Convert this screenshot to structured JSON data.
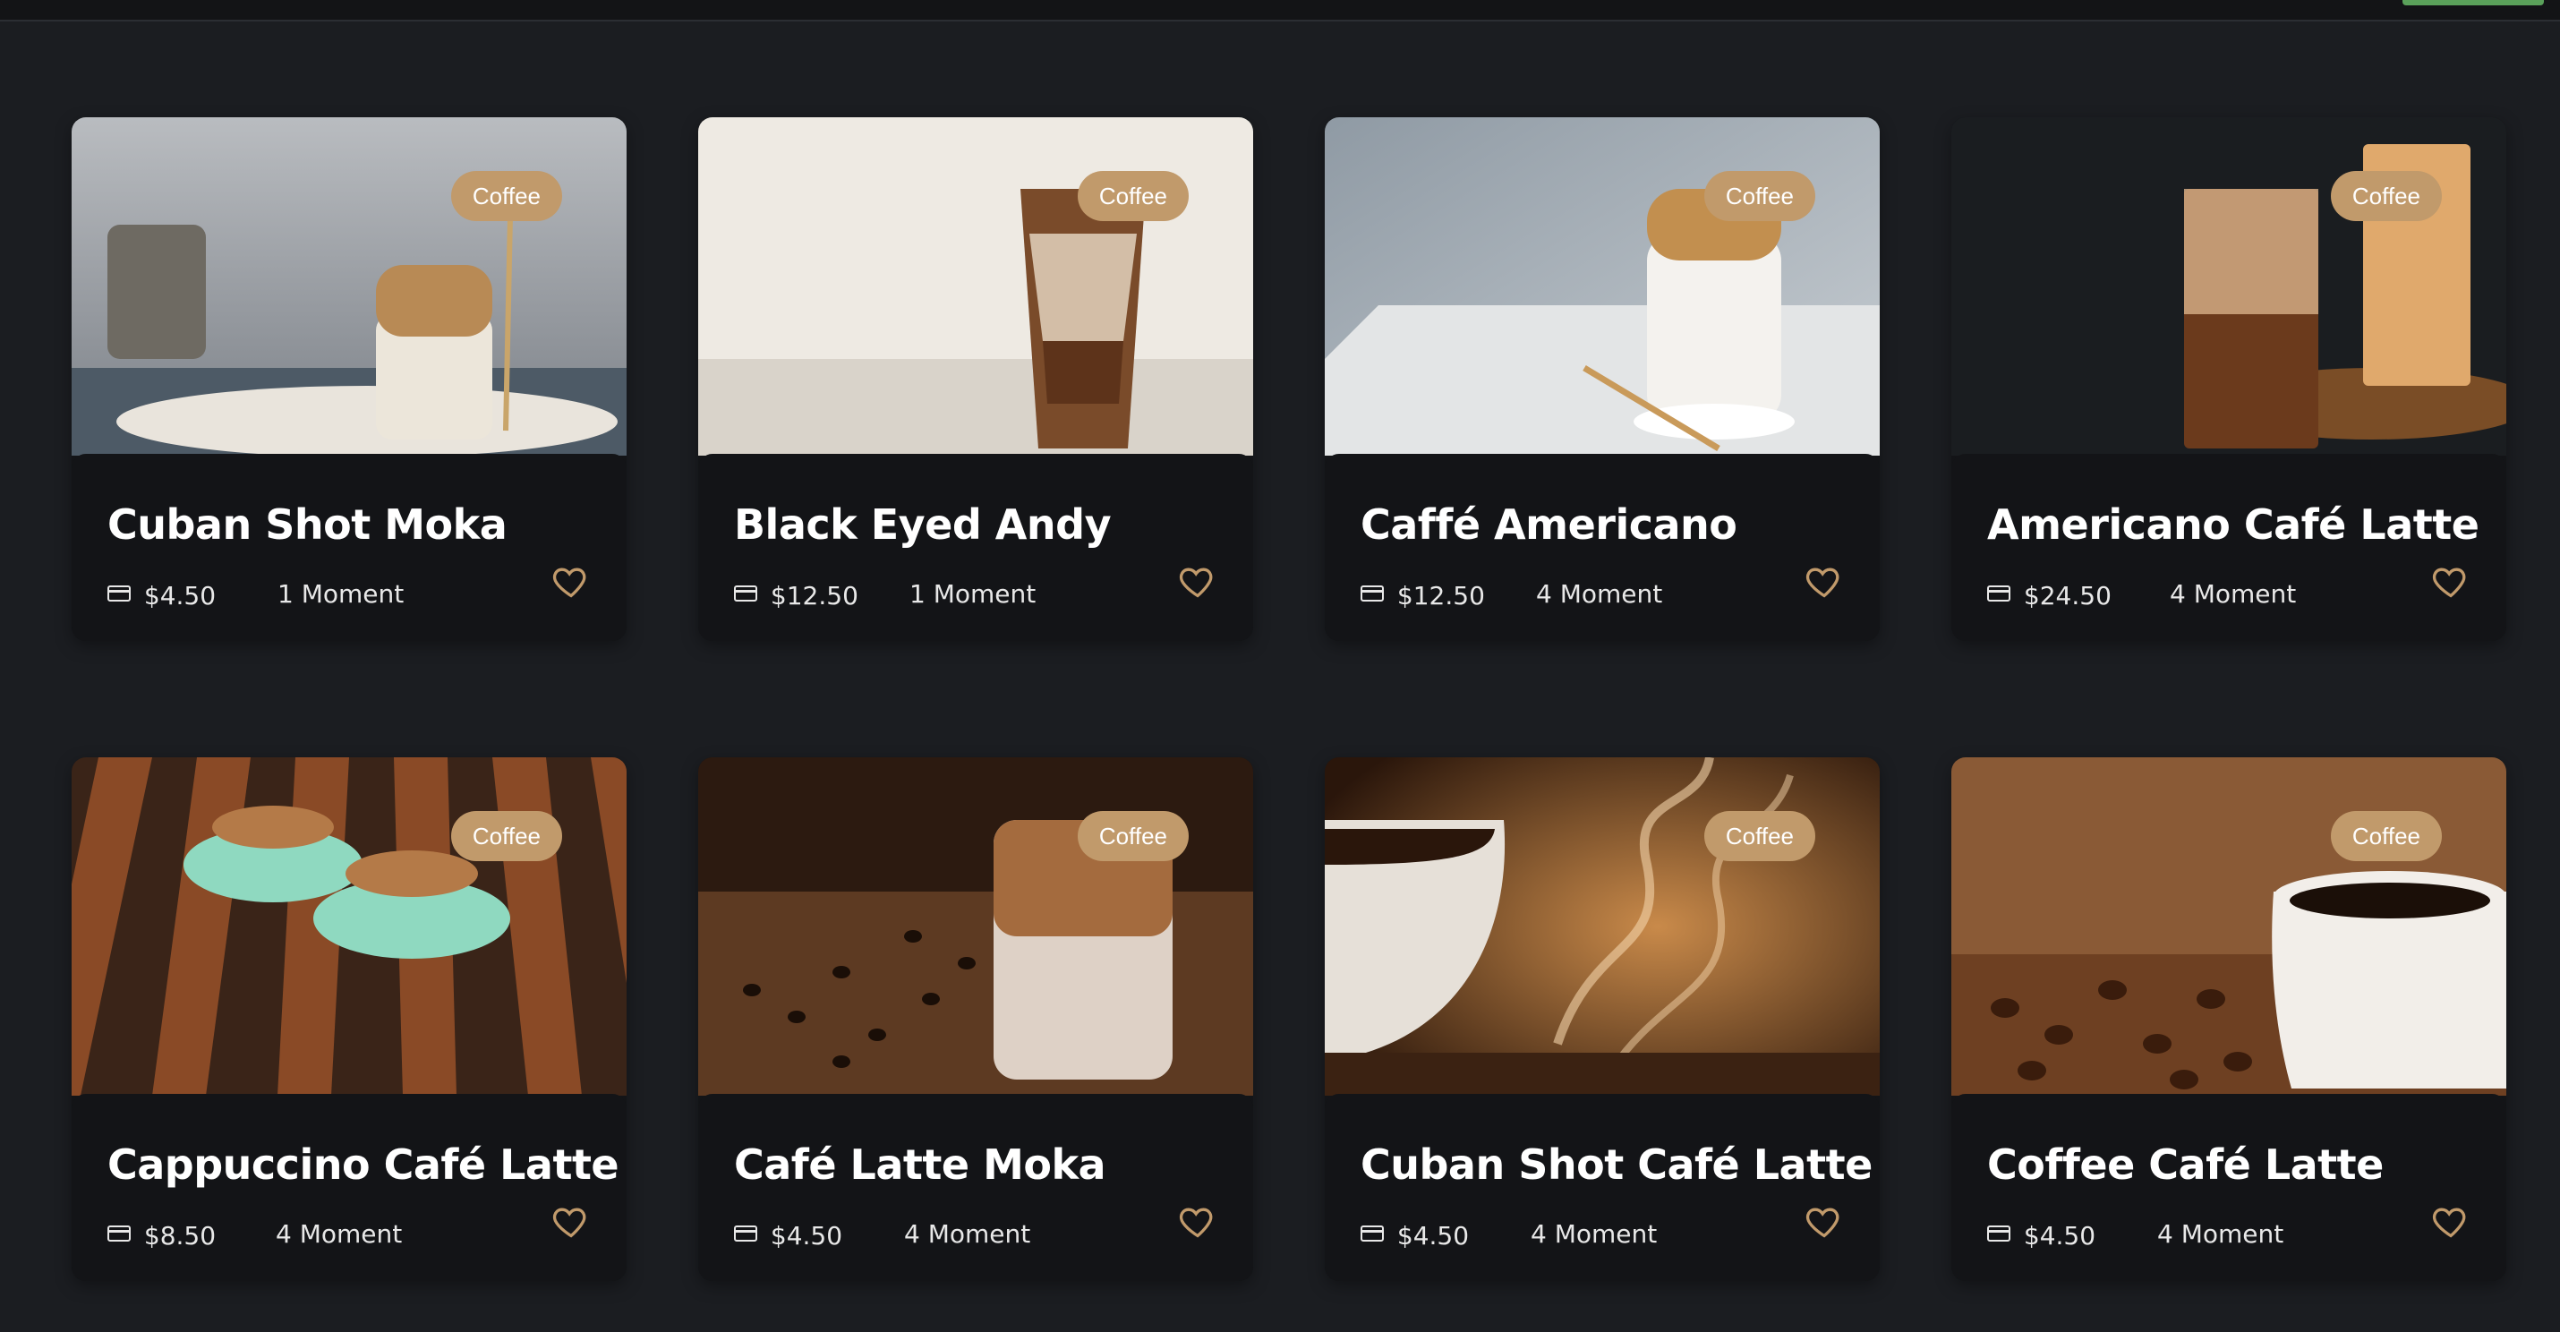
{
  "accent_color": "#c19a6b",
  "cards": [
    {
      "title": "Cuban Shot Moka",
      "badge": "Coffee",
      "price": "$4.50",
      "moment": "1 Moment",
      "icon": "heart-icon"
    },
    {
      "title": "Black Eyed Andy",
      "badge": "Coffee",
      "price": "$12.50",
      "moment": "1 Moment",
      "icon": "heart-icon"
    },
    {
      "title": "Caffé Americano",
      "badge": "Coffee",
      "price": "$12.50",
      "moment": "4 Moment",
      "icon": "heart-icon"
    },
    {
      "title": "Americano Café Latte",
      "badge": "Coffee",
      "price": "$24.50",
      "moment": "4 Moment",
      "icon": "heart-icon"
    },
    {
      "title": "Cappuccino Café Latte",
      "badge": "Coffee",
      "price": "$8.50",
      "moment": "4 Moment",
      "icon": "heart-icon"
    },
    {
      "title": "Café Latte Moka",
      "badge": "Coffee",
      "price": "$4.50",
      "moment": "4 Moment",
      "icon": "heart-icon"
    },
    {
      "title": "Cuban Shot Café Latte",
      "badge": "Coffee",
      "price": "$4.50",
      "moment": "4 Moment",
      "icon": "heart-icon"
    },
    {
      "title": "Coffee Café Latte",
      "badge": "Coffee",
      "price": "$4.50",
      "moment": "4 Moment",
      "icon": "heart-icon"
    }
  ]
}
